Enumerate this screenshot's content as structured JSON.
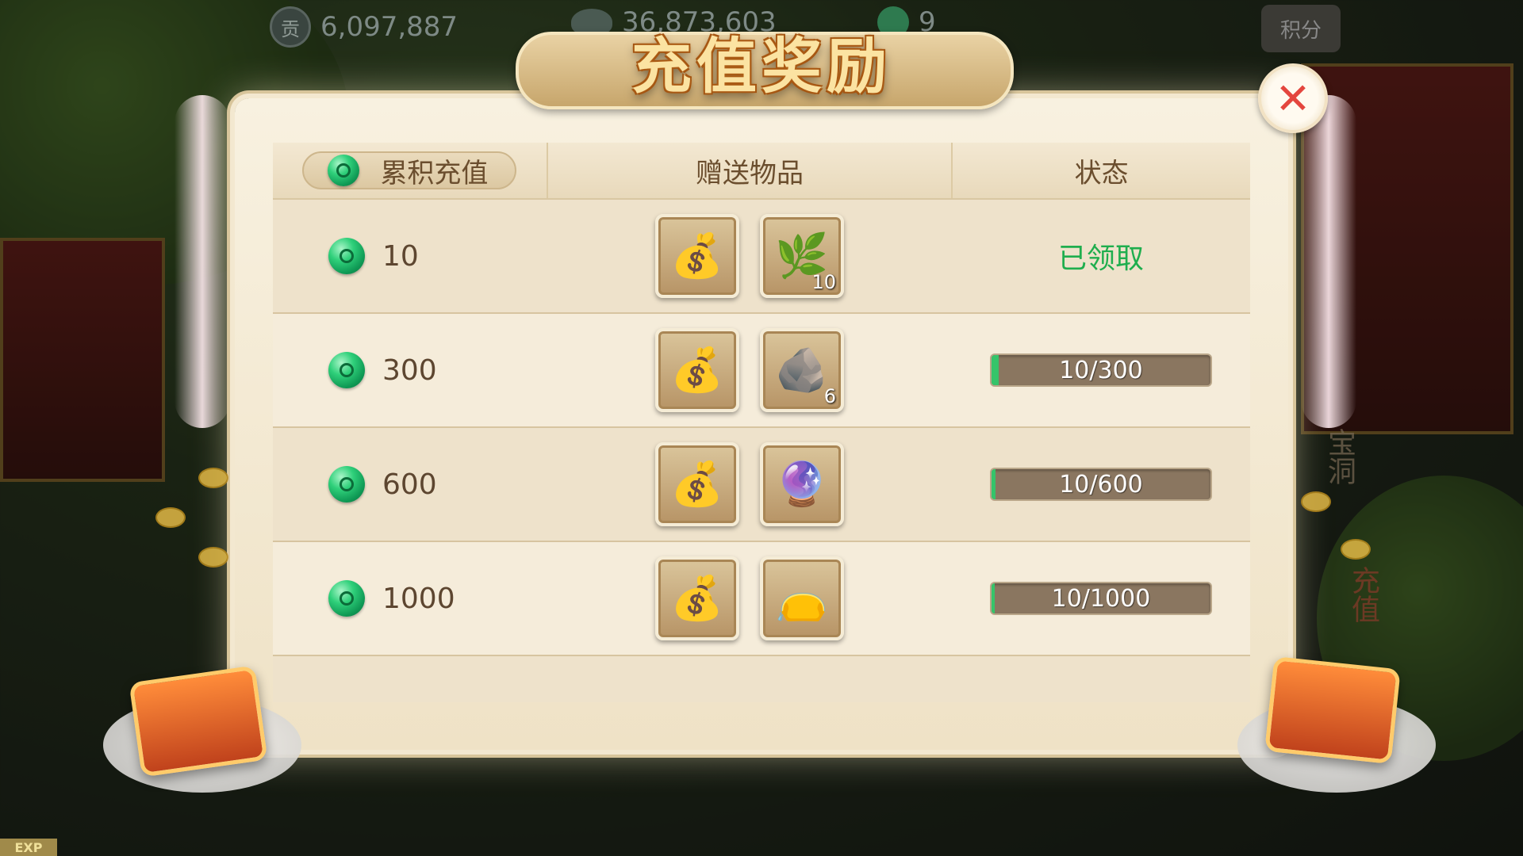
{
  "currency": {
    "contribution_icon": "贡",
    "contribution": "6,097,887",
    "ingots": "36,873,603",
    "jade": "9",
    "score_label": "积分"
  },
  "dialog": {
    "title": "充值奖励",
    "close_icon": "✕",
    "headers": {
      "cumulative": "累积充值",
      "gifts": "赠送物品",
      "status": "状态"
    },
    "rows": [
      {
        "amount": "10",
        "items": [
          {
            "icon": "💰",
            "name": "silver-ingot-bag-icon",
            "count": ""
          },
          {
            "icon": "🌿",
            "name": "vase-icon",
            "count": "10"
          }
        ],
        "status": "已领取",
        "claimed": true,
        "progress": 1.0
      },
      {
        "amount": "300",
        "items": [
          {
            "icon": "💰",
            "name": "silver-ingot-bag-icon",
            "count": ""
          },
          {
            "icon": "🪨",
            "name": "dark-stone-icon",
            "count": "6"
          }
        ],
        "status": "10/300",
        "claimed": false,
        "progress": 0.033
      },
      {
        "amount": "600",
        "items": [
          {
            "icon": "💰",
            "name": "silver-ingot-bag-icon",
            "count": ""
          },
          {
            "icon": "🔮",
            "name": "crystal-ball-icon",
            "count": ""
          }
        ],
        "status": "10/600",
        "claimed": false,
        "progress": 0.017
      },
      {
        "amount": "1000",
        "items": [
          {
            "icon": "💰",
            "name": "silver-ingot-bag-icon",
            "count": ""
          },
          {
            "icon": "👝",
            "name": "gift-pouch-icon",
            "count": ""
          }
        ],
        "status": "10/1000",
        "claimed": false,
        "progress": 0.01
      }
    ]
  },
  "side": {
    "label_1": "宝洞",
    "label_2": "充值",
    "exp": "EXP"
  },
  "colors": {
    "claimed": "#1fae4e",
    "close": "#e4463e",
    "title": "#fbe3a2"
  }
}
